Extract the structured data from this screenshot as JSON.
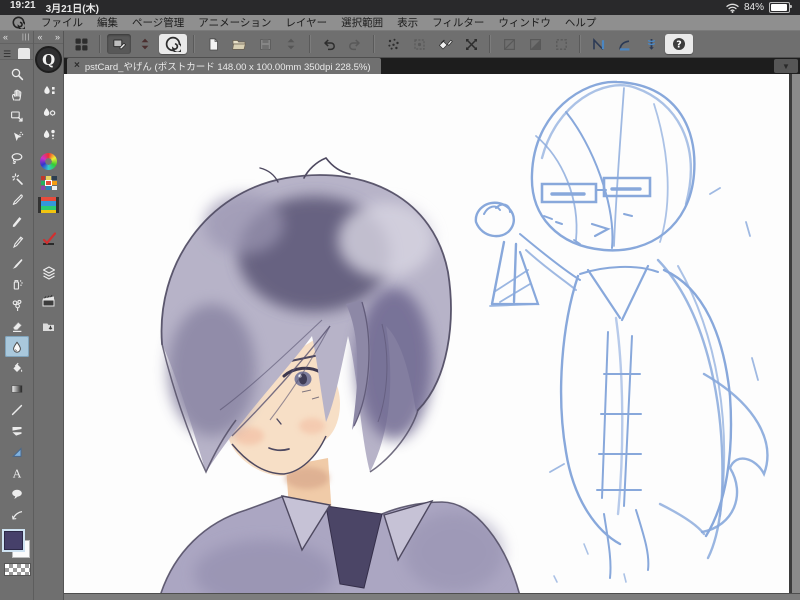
{
  "status_bar": {
    "time": "19:21",
    "date": "3月21日(木)",
    "battery_percent": "84%",
    "wifi_icon": "wifi",
    "battery_icon": "battery"
  },
  "menu_bar": {
    "logo_icon": "clip-studio-spiral",
    "items": [
      "ファイル",
      "編集",
      "ページ管理",
      "アニメーション",
      "レイヤー",
      "選択範囲",
      "表示",
      "フィルター",
      "ウィンドウ",
      "ヘルプ"
    ]
  },
  "toolbar": {
    "buttons": [
      {
        "name": "workspace-grid",
        "state": "normal"
      },
      {
        "name": "canvas-settings",
        "state": "pressed"
      },
      {
        "name": "stepper",
        "state": "normal"
      },
      {
        "name": "open-clip-studio",
        "state": "highlighted"
      },
      {
        "name": "new-canvas",
        "state": "normal"
      },
      {
        "name": "open-file",
        "state": "normal"
      },
      {
        "name": "save",
        "state": "disabled"
      },
      {
        "name": "save-stepper",
        "state": "disabled"
      },
      {
        "name": "undo",
        "state": "normal"
      },
      {
        "name": "redo",
        "state": "disabled"
      },
      {
        "name": "snap-off",
        "state": "normal"
      },
      {
        "name": "snap-frame",
        "state": "disabled"
      },
      {
        "name": "fill",
        "state": "normal"
      },
      {
        "name": "transform",
        "state": "normal"
      },
      {
        "name": "thumbnail",
        "state": "disabled"
      },
      {
        "name": "layer-clip",
        "state": "disabled"
      },
      {
        "name": "selection-area",
        "state": "disabled"
      },
      {
        "name": "snap-ruler",
        "state": "accent"
      },
      {
        "name": "snap-special-ruler",
        "state": "accent"
      },
      {
        "name": "snap-grid",
        "state": "accent"
      },
      {
        "name": "help",
        "state": "highlighted"
      }
    ],
    "help_glyph": "?"
  },
  "tab_bar": {
    "document_tab": {
      "close_glyph": "×",
      "title": "pstCard_やげん (ポストカード 148.00 x 100.00mm 350dpi 228.5%)"
    },
    "tab_menu_glyph": "▼"
  },
  "tool_palette": {
    "collapse_glyph": "«",
    "tools": [
      "zoom",
      "hand",
      "move-canvas",
      "operation",
      "lasso",
      "auto-select",
      "eyedropper",
      "pen",
      "marker",
      "brush",
      "airbrush",
      "decoration",
      "eraser",
      "blend",
      "fill-bucket",
      "gradient",
      "figure",
      "frame-border",
      "ruler",
      "text",
      "balloon",
      "line-correct"
    ],
    "selected_tool": "blend",
    "text_tool_glyph": "A",
    "foreground_color": "#46406a",
    "background_color": "#fbfbfb"
  },
  "panel_dock": {
    "collapse_glyph": "«",
    "expand_glyph": "»",
    "clip_logo_glyph": "Q",
    "panels": [
      "sub-tool",
      "tool-property",
      "brush-size",
      "color-wheel",
      "color-set",
      "color-history",
      "auto-action",
      "layer",
      "timeline",
      "material-export"
    ]
  },
  "colors": {
    "menu_gray": "#8f8f8f",
    "ui_gray": "#6f6f6f",
    "tabbar_dark": "#1d1d1d",
    "accent_blue": "#4b86c2",
    "selected_tool_bg": "#a9c8dc",
    "sketch_blue": "#82a4da",
    "hair_base": "#b7b3c8",
    "hair_dark": "#5a5474",
    "skin": "#f7dfc6",
    "shirt": "#aba6c2",
    "tie_dark": "#4b4566",
    "canvas_white": "#fdfdfd"
  }
}
